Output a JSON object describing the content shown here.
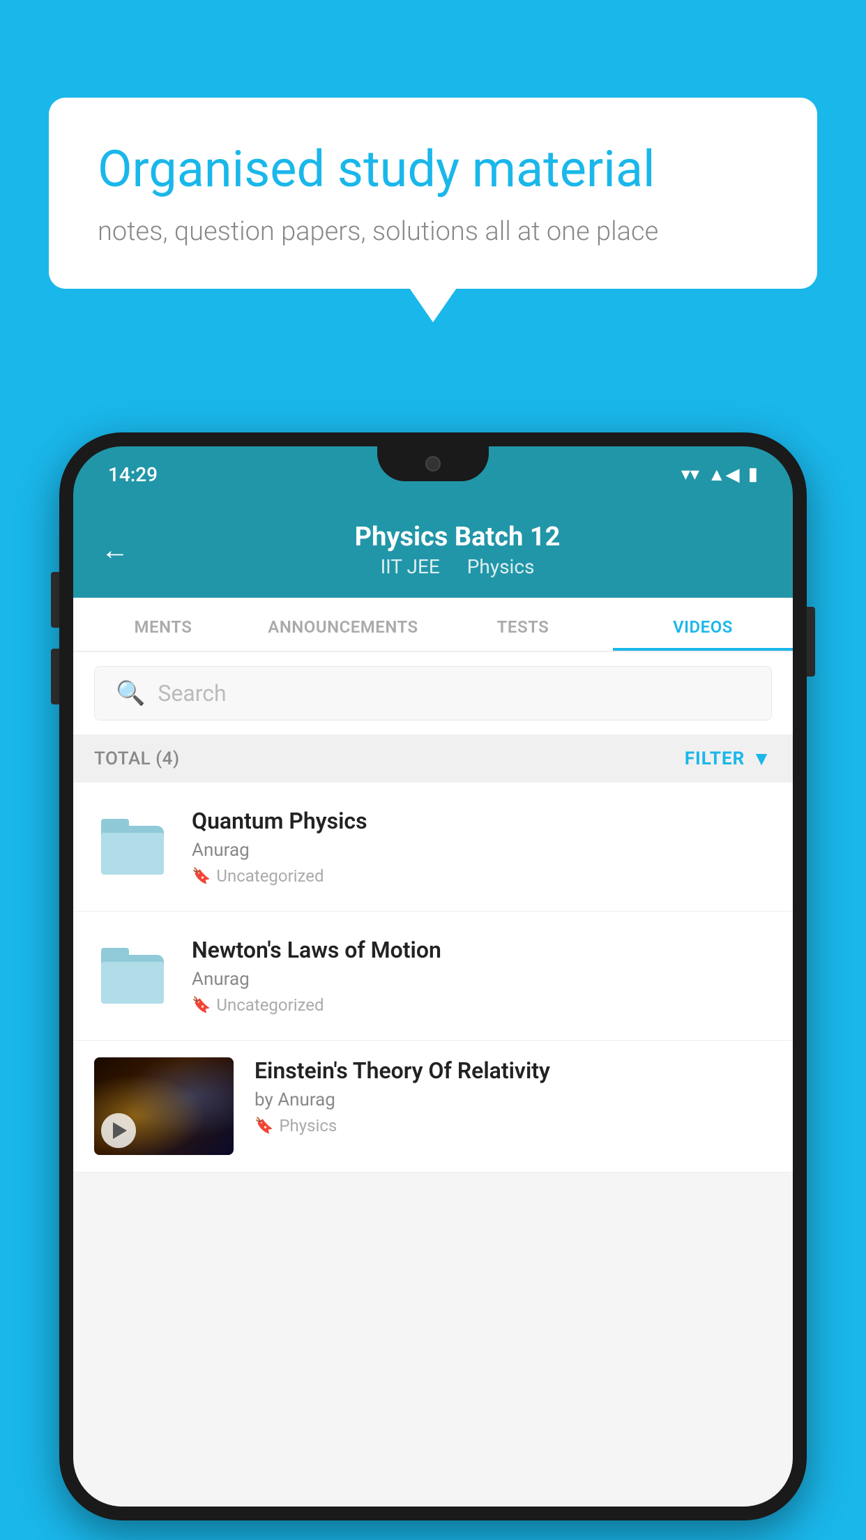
{
  "background_color": "#1ab7ea",
  "speech_bubble": {
    "title": "Organised study material",
    "subtitle": "notes, question papers, solutions all at one place"
  },
  "phone": {
    "status_bar": {
      "time": "14:29"
    },
    "header": {
      "title": "Physics Batch 12",
      "subtitle_part1": "IIT JEE",
      "subtitle_part2": "Physics",
      "back_label": "←"
    },
    "tabs": [
      {
        "label": "MENTS",
        "active": false
      },
      {
        "label": "ANNOUNCEMENTS",
        "active": false
      },
      {
        "label": "TESTS",
        "active": false
      },
      {
        "label": "VIDEOS",
        "active": true
      }
    ],
    "search": {
      "placeholder": "Search"
    },
    "filter_bar": {
      "total_label": "TOTAL (4)",
      "filter_label": "FILTER"
    },
    "videos": [
      {
        "title": "Quantum Physics",
        "author": "Anurag",
        "tag": "Uncategorized",
        "type": "folder"
      },
      {
        "title": "Newton's Laws of Motion",
        "author": "Anurag",
        "tag": "Uncategorized",
        "type": "folder"
      },
      {
        "title": "Einstein's Theory Of Relativity",
        "author": "by Anurag",
        "tag": "Physics",
        "type": "video"
      }
    ]
  }
}
